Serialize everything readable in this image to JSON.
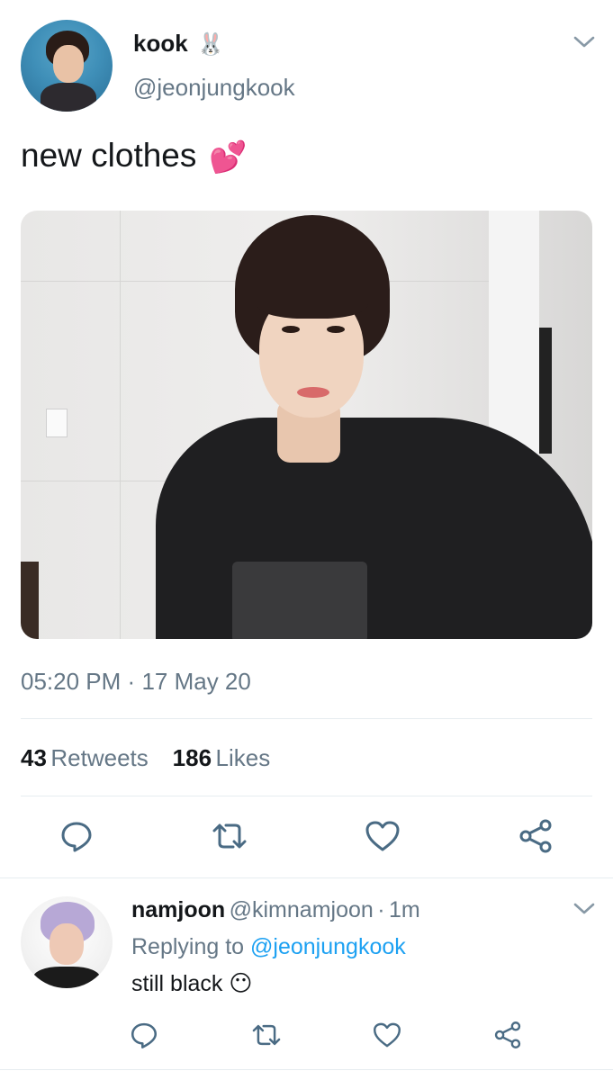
{
  "tweet": {
    "author_name": "kook",
    "author_emoji": "🐰",
    "author_handle": "@jeonjungkook",
    "text": "new clothes",
    "text_emoji": "💕",
    "time": "05:20 PM",
    "date_sep": "·",
    "date": "17 May 20",
    "retweets_count": "43",
    "retweets_label": "Retweets",
    "likes_count": "186",
    "likes_label": "Likes"
  },
  "reply": {
    "author_name": "namjoon",
    "author_handle": "@kimnamjoon",
    "sep": "·",
    "age": "1m",
    "replying_prefix": "Replying to",
    "replying_handle": "@jeonjungkook",
    "text": "still black",
    "text_emoji": "😶"
  },
  "icons": {
    "reply": "reply-icon",
    "retweet": "retweet-icon",
    "like": "heart-icon",
    "share": "share-icon",
    "menu": "chevron-down-icon"
  },
  "colors": {
    "link": "#1da1f2",
    "secondary_text": "#657786",
    "icon": "#4a6b84",
    "divider": "#e6ecf0"
  }
}
